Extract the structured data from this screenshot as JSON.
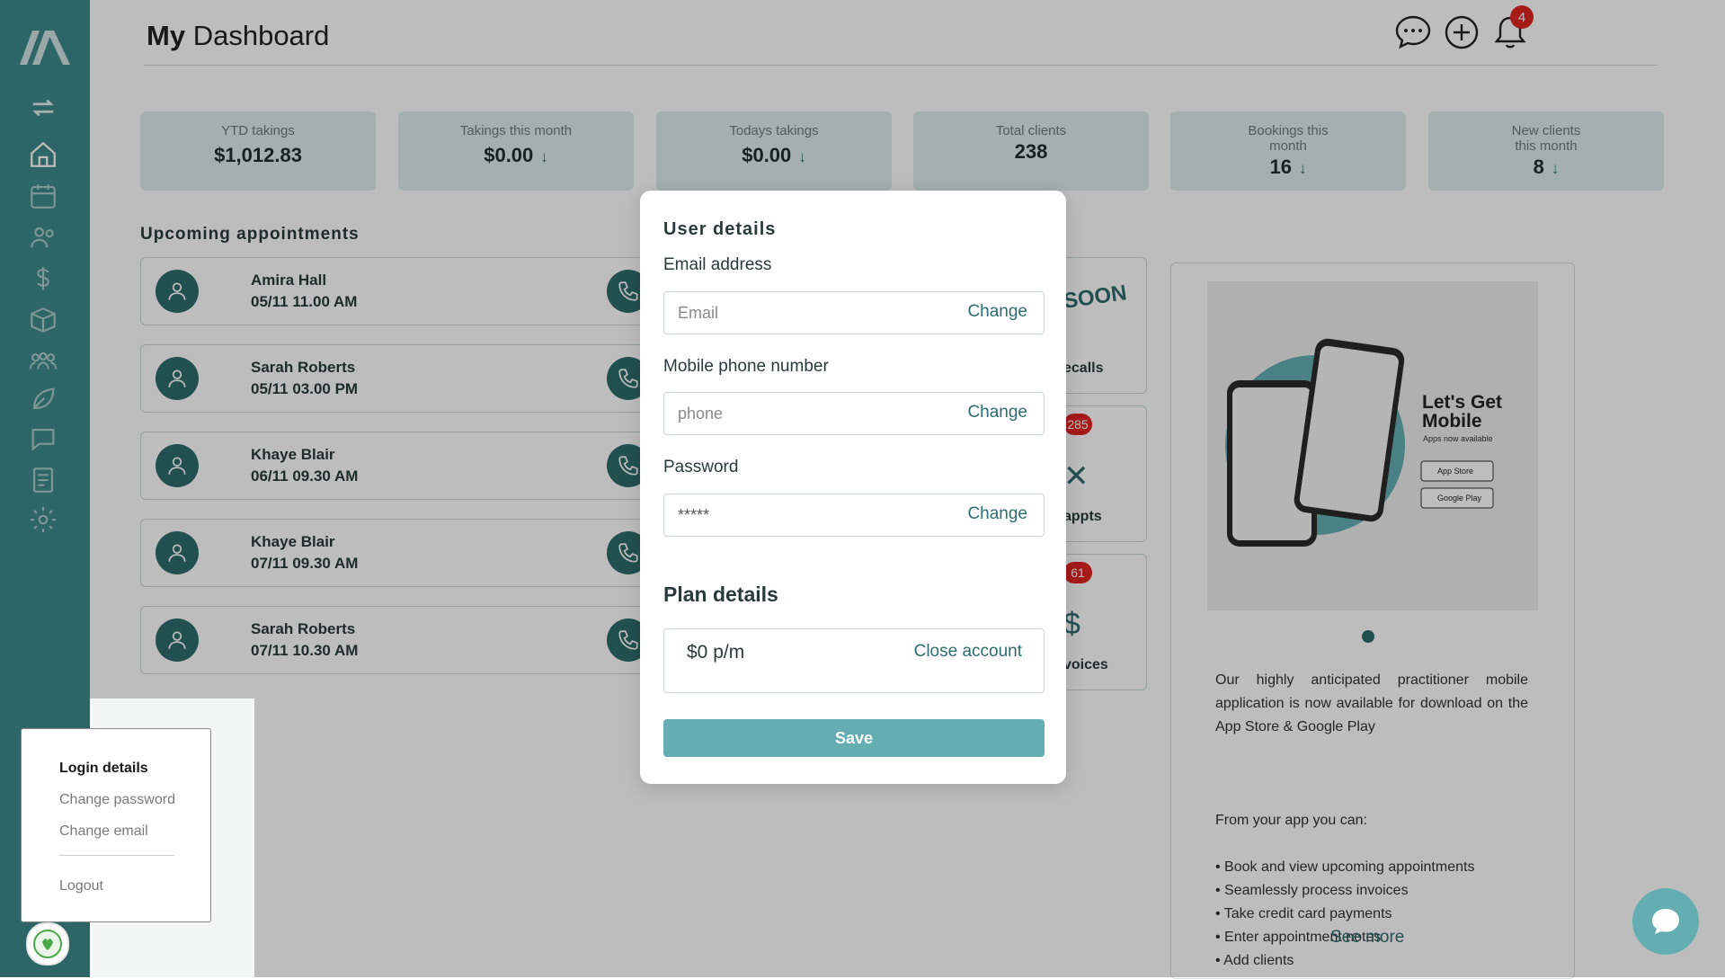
{
  "header": {
    "title_bold": "My",
    "title_rest": "Dashboard",
    "notification_count": "4",
    "icons": [
      "chat-icon",
      "add-circle-icon",
      "bell-icon"
    ]
  },
  "sidebar": {
    "icons": [
      "swap-icon",
      "home-icon",
      "calendar-icon",
      "clients-icon",
      "dollar-icon",
      "box-icon",
      "group-icon",
      "leaf-icon",
      "messages-icon",
      "notes-icon",
      "settings-icon"
    ]
  },
  "stats": [
    {
      "label": "YTD takings",
      "value": "$1,012.83",
      "arrow": ""
    },
    {
      "label": "Takings this month",
      "value": "$0.00",
      "arrow": "↓"
    },
    {
      "label": "Todays takings",
      "value": "$0.00",
      "arrow": "↓"
    },
    {
      "label": "Total clients",
      "value": "238",
      "arrow": ""
    },
    {
      "label": "Bookings this month",
      "value": "16",
      "arrow": "↓"
    },
    {
      "label": "New clients this month",
      "value": "8",
      "arrow": "↓"
    }
  ],
  "appointments": {
    "heading": "Upcoming appointments",
    "items": [
      {
        "name": "Amira Hall",
        "when": "05/11 11.00 AM"
      },
      {
        "name": "Sarah Roberts",
        "when": "05/11 03.00 PM"
      },
      {
        "name": "Khaye Blair",
        "when": "06/11 09.30 AM"
      },
      {
        "name": "Khaye Blair",
        "when": "07/11 09.30 AM"
      },
      {
        "name": "Sarah Roberts",
        "when": "07/11 10.30 AM"
      }
    ]
  },
  "tiles": [
    {
      "label": "ecalls",
      "badge": "",
      "art": "SOON"
    },
    {
      "label": "appts",
      "badge": "285",
      "art": ""
    },
    {
      "label": "voices",
      "badge": "61",
      "art": ""
    }
  ],
  "promo": {
    "headline_line1": "Let's Get",
    "headline_line2": "Mobile",
    "sub": "Apps now available",
    "app_store": "App Store",
    "google_play": "Google Play",
    "text": "Our highly anticipated practitioner mobile application is now available for download on the App Store & Google Play",
    "list_intro": "From your app you can:",
    "list": [
      "• Book and view upcoming appointments",
      "• Seamlessly process invoices",
      "• Take credit card payments",
      "• Enter appointment notes",
      "• Add clients"
    ],
    "see_more": "See more"
  },
  "modal": {
    "title": "User details",
    "email_label": "Email address",
    "email_placeholder": "Email",
    "phone_label": "Mobile phone number",
    "phone_placeholder": "phone",
    "password_label": "Password",
    "password_value": "*****",
    "change_label": "Change",
    "plan_title": "Plan details",
    "plan_price": "$0 p/m",
    "close_account": "Close account",
    "save": "Save"
  },
  "account_menu": {
    "items": [
      "Login details",
      "Change password",
      "Change email"
    ],
    "logout": "Logout"
  },
  "colors": {
    "sidebar": "#3f8a8c",
    "accent": "#2f6c6e",
    "button": "#64aeb2",
    "badge": "#e02424"
  }
}
